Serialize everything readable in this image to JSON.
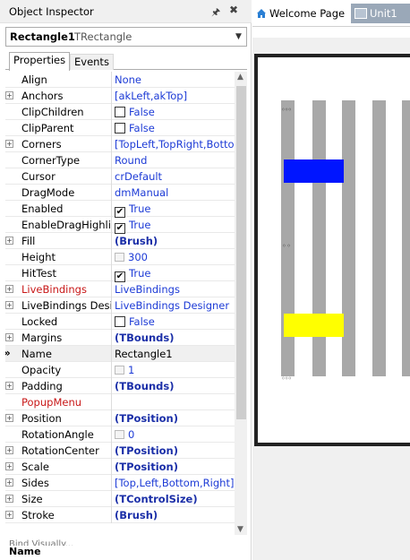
{
  "inspector": {
    "title": "Object Inspector",
    "object_name": "Rectangle1",
    "object_type": "TRectangle",
    "tabs": [
      "Properties",
      "Events"
    ],
    "properties": [
      {
        "name": "Align",
        "value": "None"
      },
      {
        "name": "Anchors",
        "value": "[akLeft,akTop]",
        "expandable": true
      },
      {
        "name": "ClipChildren",
        "value": "False",
        "checkbox": true
      },
      {
        "name": "ClipParent",
        "value": "False",
        "checkbox": true
      },
      {
        "name": "Corners",
        "value": "[TopLeft,TopRight,BottomLeft,BottomRight]",
        "expandable": true
      },
      {
        "name": "CornerType",
        "value": "Round"
      },
      {
        "name": "Cursor",
        "value": "crDefault"
      },
      {
        "name": "DragMode",
        "value": "dmManual"
      },
      {
        "name": "Enabled",
        "value": "True",
        "checkbox": true,
        "checked": true
      },
      {
        "name": "EnableDragHighlight",
        "value": "True",
        "checkbox": true,
        "checked": true
      },
      {
        "name": "Fill",
        "value": "(Brush)",
        "expandable": true,
        "bold": true
      },
      {
        "name": "Height",
        "value": "300",
        "ghost": true
      },
      {
        "name": "HitTest",
        "value": "True",
        "checkbox": true,
        "checked": true
      },
      {
        "name": "LiveBindings",
        "value": "LiveBindings",
        "expandable": true,
        "red": true
      },
      {
        "name": "LiveBindings Designer",
        "value": "LiveBindings Designer",
        "expandable": true
      },
      {
        "name": "Locked",
        "value": "False",
        "checkbox": true
      },
      {
        "name": "Margins",
        "value": "(TBounds)",
        "expandable": true,
        "bold": true
      },
      {
        "name": "Name",
        "value": "Rectangle1",
        "selected": true
      },
      {
        "name": "Opacity",
        "value": "1",
        "ghost": true
      },
      {
        "name": "Padding",
        "value": "(TBounds)",
        "expandable": true,
        "bold": true
      },
      {
        "name": "PopupMenu",
        "value": "",
        "red": true
      },
      {
        "name": "Position",
        "value": "(TPosition)",
        "expandable": true,
        "bold": true
      },
      {
        "name": "RotationAngle",
        "value": "0",
        "ghost": true
      },
      {
        "name": "RotationCenter",
        "value": "(TPosition)",
        "expandable": true,
        "bold": true
      },
      {
        "name": "Scale",
        "value": "(TPosition)",
        "expandable": true,
        "bold": true
      },
      {
        "name": "Sides",
        "value": "[Top,Left,Bottom,Right]",
        "expandable": true
      },
      {
        "name": "Size",
        "value": "(TControlSize)",
        "expandable": true,
        "bold": true
      },
      {
        "name": "Stroke",
        "value": "(Brush)",
        "expandable": true,
        "bold": true
      }
    ],
    "bind_visually": "Bind Visually...",
    "status_name": "Name"
  },
  "designer": {
    "tabs": [
      "Welcome Page",
      "Unit1"
    ],
    "colors": {
      "blue_box": "#0015ff",
      "yellow_box": "#ffff00",
      "stripe": "#a8a8a8"
    }
  },
  "icons": [
    "pin-icon",
    "close-icon",
    "dropdown-icon",
    "expand-icon",
    "home-icon",
    "form-icon"
  ]
}
